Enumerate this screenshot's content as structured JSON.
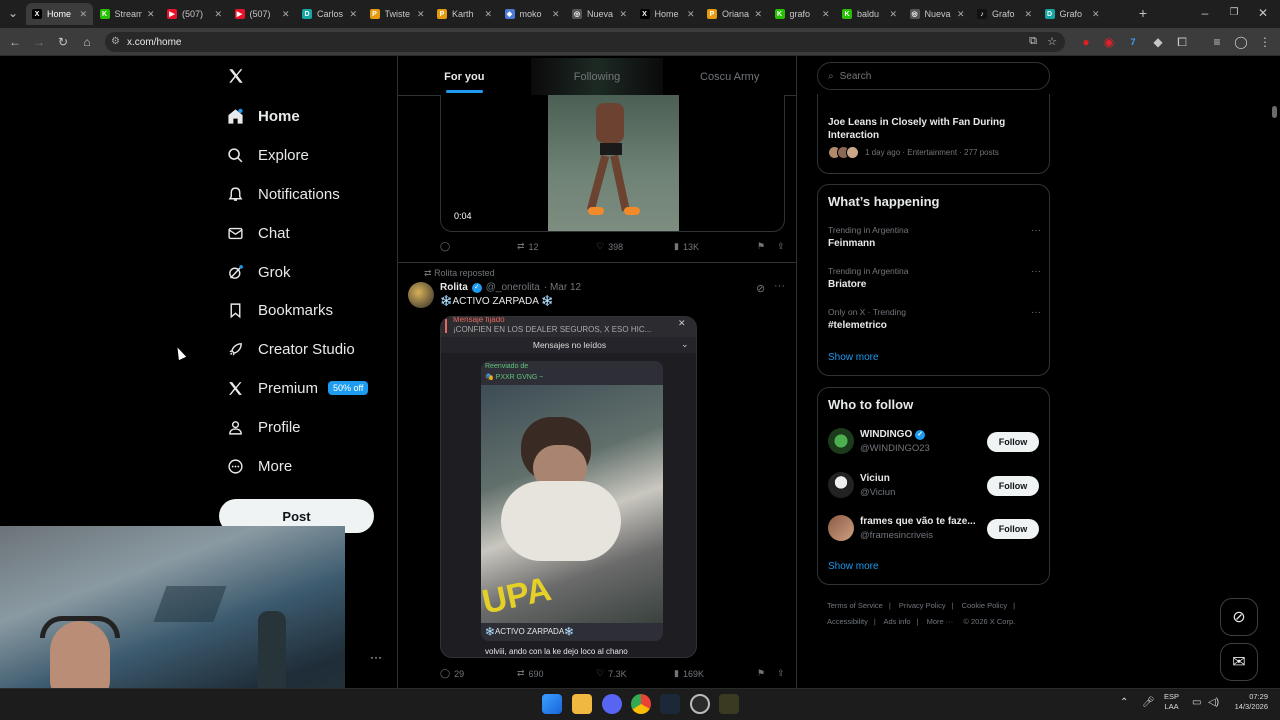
{
  "browser": {
    "tabs": [
      {
        "title": "Home",
        "fav": "X",
        "color": "#000000"
      },
      {
        "title": "Stream",
        "fav": "K",
        "color": "#27c000"
      },
      {
        "title": "(507)",
        "fav": "▶",
        "color": "#e8132b"
      },
      {
        "title": "(507)",
        "fav": "▶",
        "color": "#e8132b"
      },
      {
        "title": "Carlos",
        "fav": "D",
        "color": "#14a5a5"
      },
      {
        "title": "Twiste",
        "fav": "P",
        "color": "#e59a0f"
      },
      {
        "title": "Karth",
        "fav": "P",
        "color": "#e59a0f"
      },
      {
        "title": "moko",
        "fav": "◆",
        "color": "#4a79d8"
      },
      {
        "title": "Nueva",
        "fav": "◎",
        "color": "#555555"
      },
      {
        "title": "Home",
        "fav": "X",
        "color": "#000000"
      },
      {
        "title": "Oriana",
        "fav": "P",
        "color": "#e59a0f"
      },
      {
        "title": "grafo",
        "fav": "K",
        "color": "#27c000"
      },
      {
        "title": "baldu",
        "fav": "K",
        "color": "#27c000"
      },
      {
        "title": "Nueva",
        "fav": "◎",
        "color": "#555555"
      },
      {
        "title": "Grafo",
        "fav": "♪",
        "color": "#111111"
      },
      {
        "title": "Grafo",
        "fav": "D",
        "color": "#14a5a5"
      }
    ],
    "url": "x.com/home"
  },
  "nav": {
    "items": [
      {
        "label": "Home"
      },
      {
        "label": "Explore"
      },
      {
        "label": "Notifications"
      },
      {
        "label": "Chat"
      },
      {
        "label": "Grok"
      },
      {
        "label": "Bookmarks"
      },
      {
        "label": "Creator Studio"
      },
      {
        "label": "Premium"
      },
      {
        "label": "Profile"
      },
      {
        "label": "More"
      }
    ],
    "premium_badge": "50% off",
    "post_label": "Post"
  },
  "feed": {
    "tabs": [
      "For you",
      "Following",
      "Coscu Army"
    ],
    "post1": {
      "video_time": "0:04",
      "retweets": "12",
      "likes": "398",
      "views": "13K"
    },
    "post2": {
      "reposted_by": "Rolita reposted",
      "name": "Rolita",
      "handle": "@_onerolita",
      "date": "· Mar 12",
      "text": "❄️ACTIVO ZARPADA ❄️",
      "img_pinned": "Mensaje fijado",
      "img_banner": "¡CONFIEN EN LOS DEALER SEGUROS, X ESO HIC...",
      "img_unread": "Mensajes no leídos",
      "img_forwarded": "Reenviado de",
      "img_forwarded_from": "🎭 PXXR GVNG ~",
      "img_caption1": "❄️ACTIVO ZARPADA❄️",
      "img_caption2": "volviii, ando con la ke dejo loco al chano",
      "replies": "29",
      "retweets": "690",
      "likes": "7.3K",
      "views": "169K"
    }
  },
  "search": {
    "placeholder": "Search"
  },
  "news": {
    "title": "Joe Leans in Closely with Fan During Interaction",
    "meta": "1 day ago · Entertainment · 277 posts"
  },
  "happening": {
    "title": "What’s happening",
    "items": [
      {
        "context": "Trending in Argentina",
        "topic": "Feinmann"
      },
      {
        "context": "Trending in Argentina",
        "topic": "Briatore"
      },
      {
        "context": "Only on X · Trending",
        "topic": "#telemetrico"
      }
    ],
    "show_more": "Show more"
  },
  "follow": {
    "title": "Who to follow",
    "items": [
      {
        "name": "WINDINGO",
        "handle": "@WINDINGO23",
        "button": "Follow"
      },
      {
        "name": "Viciun",
        "handle": "@Viciun",
        "button": "Follow"
      },
      {
        "name": "frames que vão te faze...",
        "handle": "@framesincriveis",
        "button": "Follow"
      }
    ],
    "show_more": "Show more"
  },
  "footer": {
    "links": [
      "Terms of Service",
      "Privacy Policy",
      "Cookie Policy",
      "Accessibility",
      "Ads info",
      "More ···",
      "© 2026 X Corp."
    ]
  },
  "taskbar": {
    "lang1": "ESP",
    "lang2": "LAA",
    "time": "07:29",
    "date": "14/3/2026"
  }
}
